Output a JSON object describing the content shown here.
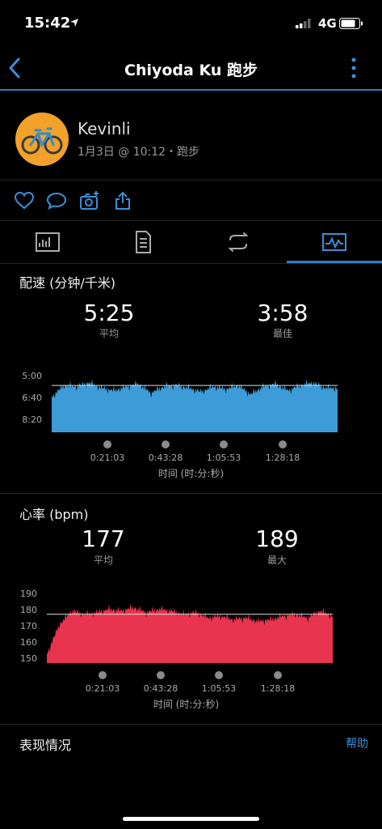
{
  "status_bar": {
    "time": "15:42",
    "network": "4G"
  },
  "header": {
    "title": "Chiyoda Ku 跑步"
  },
  "profile": {
    "name": "Kevinli",
    "subtitle": "1月3日 @ 10:12・跑步"
  },
  "pace": {
    "title": "配速 (分钟/千米)",
    "avg_value": "5:25",
    "avg_label": "平均",
    "best_value": "3:58",
    "best_label": "最佳",
    "color": "#3d9bd8"
  },
  "heart_rate": {
    "title": "心率 (bpm)",
    "avg_value": "177",
    "avg_label": "平均",
    "max_value": "189",
    "max_label": "最大",
    "color": "#e8344e"
  },
  "chart_data": [
    {
      "type": "area",
      "title": "配速 (分钟/千米)",
      "xlabel": "时间 (时:分:秒)",
      "x_ticks": [
        "0:21:03",
        "0:43:28",
        "1:05:53",
        "1:28:18"
      ],
      "y_ticks": [
        "5:00",
        "6:40",
        "8:20"
      ],
      "ylim": [
        3.8,
        9.0
      ],
      "invert_y": true,
      "reference_line": 5.42,
      "x": [
        0,
        5,
        10,
        15,
        20,
        25,
        30,
        35,
        40,
        45,
        50,
        55,
        60,
        65,
        70,
        75,
        80,
        85,
        90,
        95,
        100,
        105,
        110,
        115
      ],
      "values": [
        6.3,
        5.4,
        5.5,
        5.2,
        5.6,
        5.8,
        5.5,
        5.3,
        6.0,
        5.5,
        5.4,
        5.6,
        5.9,
        5.5,
        5.7,
        5.4,
        6.1,
        5.5,
        5.3,
        5.8,
        5.4,
        5.2,
        5.6,
        5.6
      ],
      "color": "#3d9bd8"
    },
    {
      "type": "area",
      "title": "心率 (bpm)",
      "xlabel": "时间 (时:分:秒)",
      "x_ticks": [
        "0:21:03",
        "0:43:28",
        "1:05:53",
        "1:28:18"
      ],
      "y_ticks": [
        "190",
        "180",
        "170",
        "160",
        "150"
      ],
      "ylim": [
        150,
        190
      ],
      "reference_line": 178,
      "x": [
        0,
        5,
        10,
        15,
        20,
        25,
        30,
        35,
        40,
        45,
        50,
        55,
        60,
        65,
        70,
        75,
        80,
        85,
        90,
        95,
        100,
        105,
        110,
        115
      ],
      "values": [
        155,
        172,
        180,
        178,
        179,
        181,
        180,
        182,
        179,
        181,
        180,
        178,
        179,
        176,
        177,
        175,
        176,
        174,
        175,
        177,
        178,
        176,
        180,
        177
      ],
      "color": "#e8344e"
    }
  ],
  "performance": {
    "title": "表现情况",
    "help_label": "帮助"
  }
}
